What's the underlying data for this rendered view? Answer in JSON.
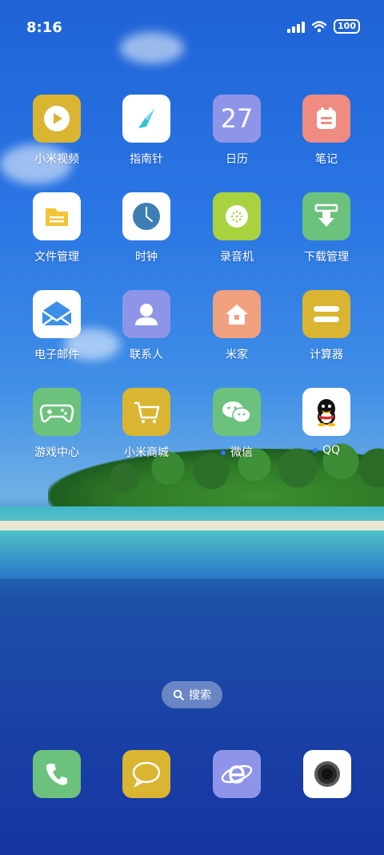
{
  "status_bar": {
    "time": "8:16",
    "battery": "100"
  },
  "apps": [
    {
      "label": "小米视频",
      "color": "#d9b531"
    },
    {
      "label": "指南针",
      "color": "#ffffff"
    },
    {
      "label": "日历",
      "color": "#8e95e8",
      "value": "27"
    },
    {
      "label": "笔记",
      "color": "#f08b82"
    },
    {
      "label": "文件管理",
      "color": "#ffffff"
    },
    {
      "label": "时钟",
      "color": "#ffffff"
    },
    {
      "label": "录音机",
      "color": "#a9d23f"
    },
    {
      "label": "下载管理",
      "color": "#6cc27d"
    },
    {
      "label": "电子邮件",
      "color": "#ffffff"
    },
    {
      "label": "联系人",
      "color": "#8e95e8"
    },
    {
      "label": "米家",
      "color": "#f0a07e"
    },
    {
      "label": "计算器",
      "color": "#d9b531"
    },
    {
      "label": "游戏中心",
      "color": "#6cc27d"
    },
    {
      "label": "小米商城",
      "color": "#d9b531"
    },
    {
      "label": "微信",
      "color": "#6cc27d",
      "new": true
    },
    {
      "label": "QQ",
      "color": "#ffffff",
      "new": true
    }
  ],
  "search": {
    "label": "搜索"
  },
  "dock": [
    {
      "name": "phone",
      "color": "#6cc27d"
    },
    {
      "name": "messages",
      "color": "#d9b531"
    },
    {
      "name": "browser",
      "color": "#8e95e8"
    },
    {
      "name": "camera",
      "color": "#ffffff"
    }
  ],
  "icons": [
    "play-icon",
    "compass-icon",
    "calendar-icon",
    "note-icon",
    "folder-icon",
    "clock-icon",
    "recorder-icon",
    "download-icon",
    "mail-icon",
    "contact-icon",
    "home-icon",
    "calculator-icon",
    "gamepad-icon",
    "cart-icon",
    "wechat-icon",
    "qq-icon",
    "search-icon",
    "phone-icon",
    "message-icon",
    "browser-icon",
    "camera-icon",
    "wifi-icon",
    "signal-icon",
    "battery-icon"
  ]
}
